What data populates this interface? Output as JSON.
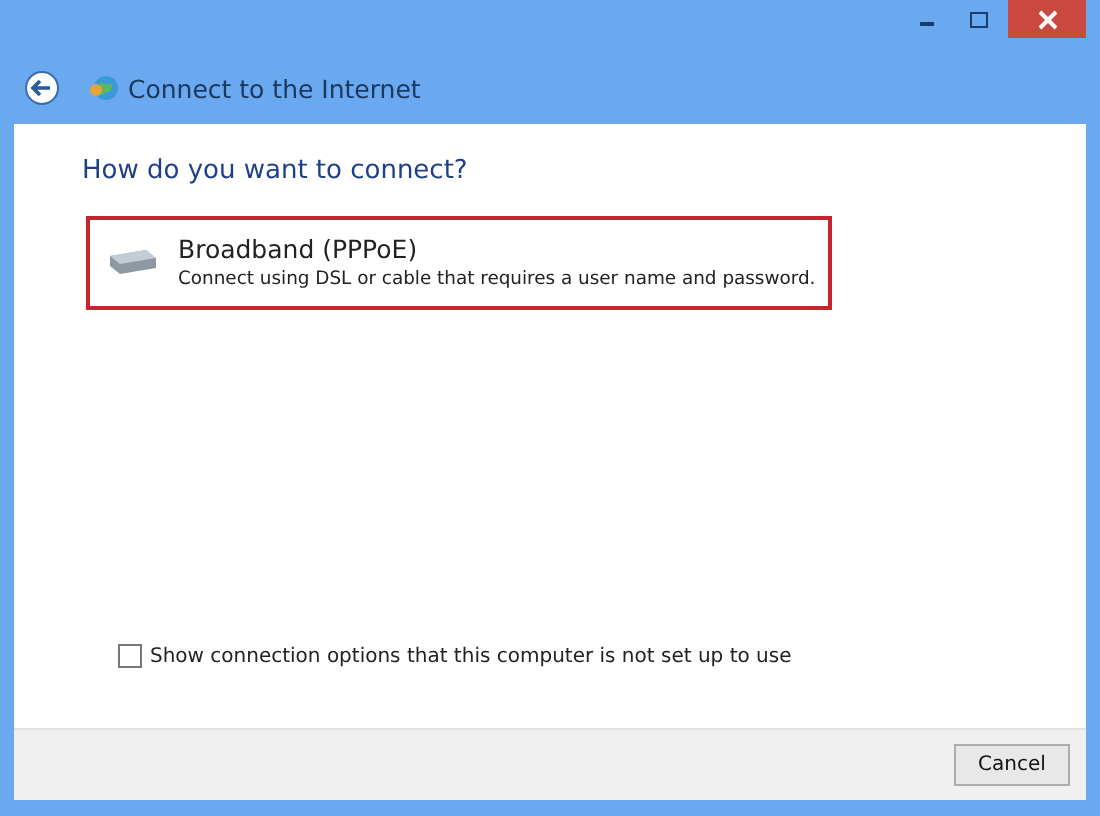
{
  "window": {
    "title": "Connect to the Internet"
  },
  "heading": "How do you want to connect?",
  "options": [
    {
      "title": "Broadband (PPPoE)",
      "description": "Connect using DSL or cable that requires a user name and password.",
      "selected": true
    }
  ],
  "checkbox": {
    "label": "Show connection options that this computer is not set up to use",
    "checked": false
  },
  "buttons": [
    "Cancel"
  ]
}
